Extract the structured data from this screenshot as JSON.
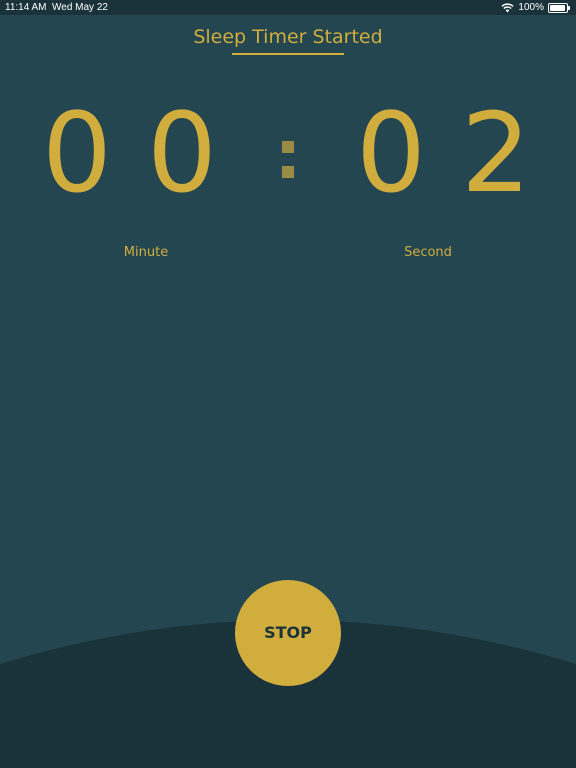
{
  "status_bar": {
    "time": "11:14 AM",
    "date": "Wed May 22",
    "battery": "100%",
    "wifi_icon": "wifi-icon",
    "battery_icon": "battery-icon",
    "battery_level": 1.0
  },
  "header": {
    "title": "Sleep Timer Started"
  },
  "timer": {
    "minute_digits": [
      "0",
      "0"
    ],
    "second_digits": [
      "0",
      "2"
    ],
    "minute_label": "Minute",
    "second_label": "Second"
  },
  "controls": {
    "stop_label": "STOP"
  },
  "colors": {
    "background": "#244651",
    "accent": "#d1ad3d",
    "status_bar": "#1a333b",
    "bottom_arc": "#1a333b",
    "colon": "#9a8a44"
  }
}
